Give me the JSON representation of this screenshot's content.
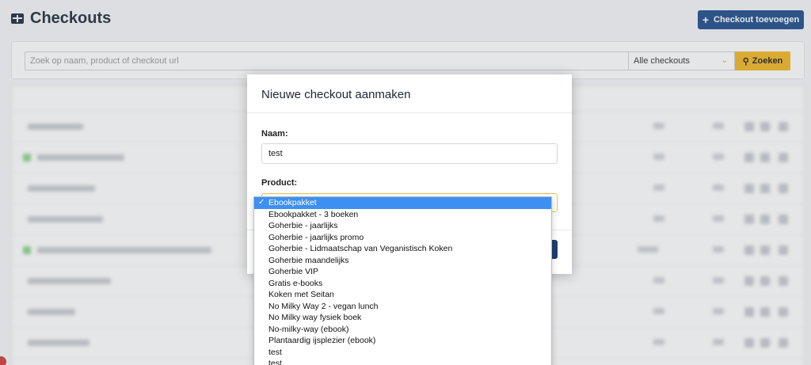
{
  "header": {
    "title": "Checkouts",
    "add_button_label": "Checkout toevoegen"
  },
  "search": {
    "placeholder": "Zoek op naam, product of checkout url",
    "filter_value": "Alle checkouts",
    "button_label": "Zoeken"
  },
  "modal": {
    "title": "Nieuwe checkout aanmaken",
    "name_label": "Naam:",
    "name_value": "test",
    "product_label": "Product:"
  },
  "product_options": [
    "Ebookpakket",
    "Ebookpakket - 3 boeken",
    "Goherbie - jaarlijks",
    "Goherbie - jaarlijks promo",
    "Goherbie - Lidmaatschap van Veganistisch Koken",
    "Goherbie maandelijks",
    "Goherbie VIP",
    "Gratis e-books",
    "Koken met Seitan",
    "No Milky Way 2 - vegan lunch",
    "No Milky way fysiek boek",
    "No-milky-way (ebook)",
    "Plantaardig ijsplezier (ebook)",
    "test",
    "test"
  ],
  "selected_option_index": 0,
  "colors": {
    "primary": "#1f4e8c",
    "accent": "#f2b824",
    "selected": "#3d8ff1"
  }
}
